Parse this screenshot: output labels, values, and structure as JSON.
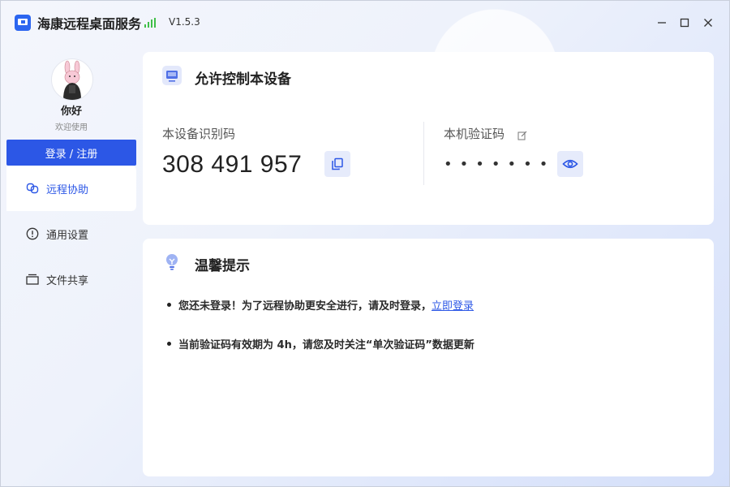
{
  "app": {
    "title": "海康远程桌面服务",
    "version": "V1.5.3",
    "accent_color": "#2c57e6",
    "signal_color": "#3fbf48"
  },
  "window_controls": {
    "minimize": "–",
    "maximize": "□",
    "close": "✕"
  },
  "user": {
    "name": "你好",
    "subtitle": "欢迎使用",
    "login_label": "登录 / 注册"
  },
  "sidebar": {
    "items": [
      {
        "label": "远程协助",
        "icon": "link-icon",
        "active": true
      },
      {
        "label": "通用设置",
        "icon": "info-circle-icon",
        "active": false
      },
      {
        "label": "文件共享",
        "icon": "folder-icon",
        "active": false
      }
    ]
  },
  "control_card": {
    "title": "允许控制本设备",
    "device_id_label": "本设备识别码",
    "device_id": "308 491 957",
    "code_label": "本机验证码",
    "code_masked": "••••••••"
  },
  "tips_card": {
    "title": "温馨提示",
    "tip1_text": "您还未登录！为了远程协助更安全进行，请及时登录，",
    "tip1_link": "立即登录",
    "tip2_text": "当前验证码有效期为 4h，请您及时关注“单次验证码”数据更新"
  }
}
